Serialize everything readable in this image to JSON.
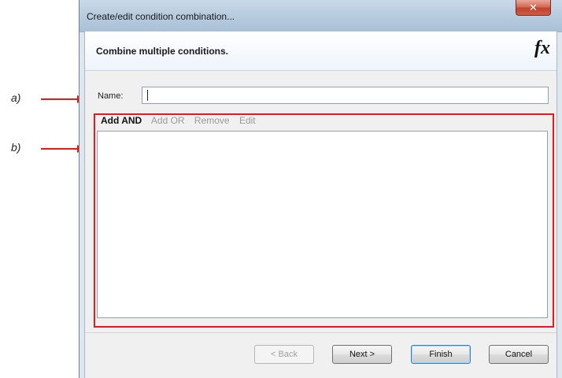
{
  "annotations": {
    "a_label": "a)",
    "b_label": "b)"
  },
  "window": {
    "title": "Create/edit condition combination...",
    "close_label": "✕"
  },
  "header": {
    "heading": "Combine multiple conditions.",
    "icon_name": "fx-icon",
    "icon_glyph": "fx"
  },
  "form": {
    "name_label": "Name:",
    "name_value": ""
  },
  "toolbar": {
    "add_and": "Add AND",
    "add_or": "Add OR",
    "remove": "Remove",
    "edit": "Edit"
  },
  "buttons": {
    "back": "< Back",
    "next": "Next >",
    "finish": "Finish",
    "cancel": "Cancel"
  },
  "colors": {
    "highlight_red": "#e31b1b",
    "title_bar": "#b9cde0"
  }
}
